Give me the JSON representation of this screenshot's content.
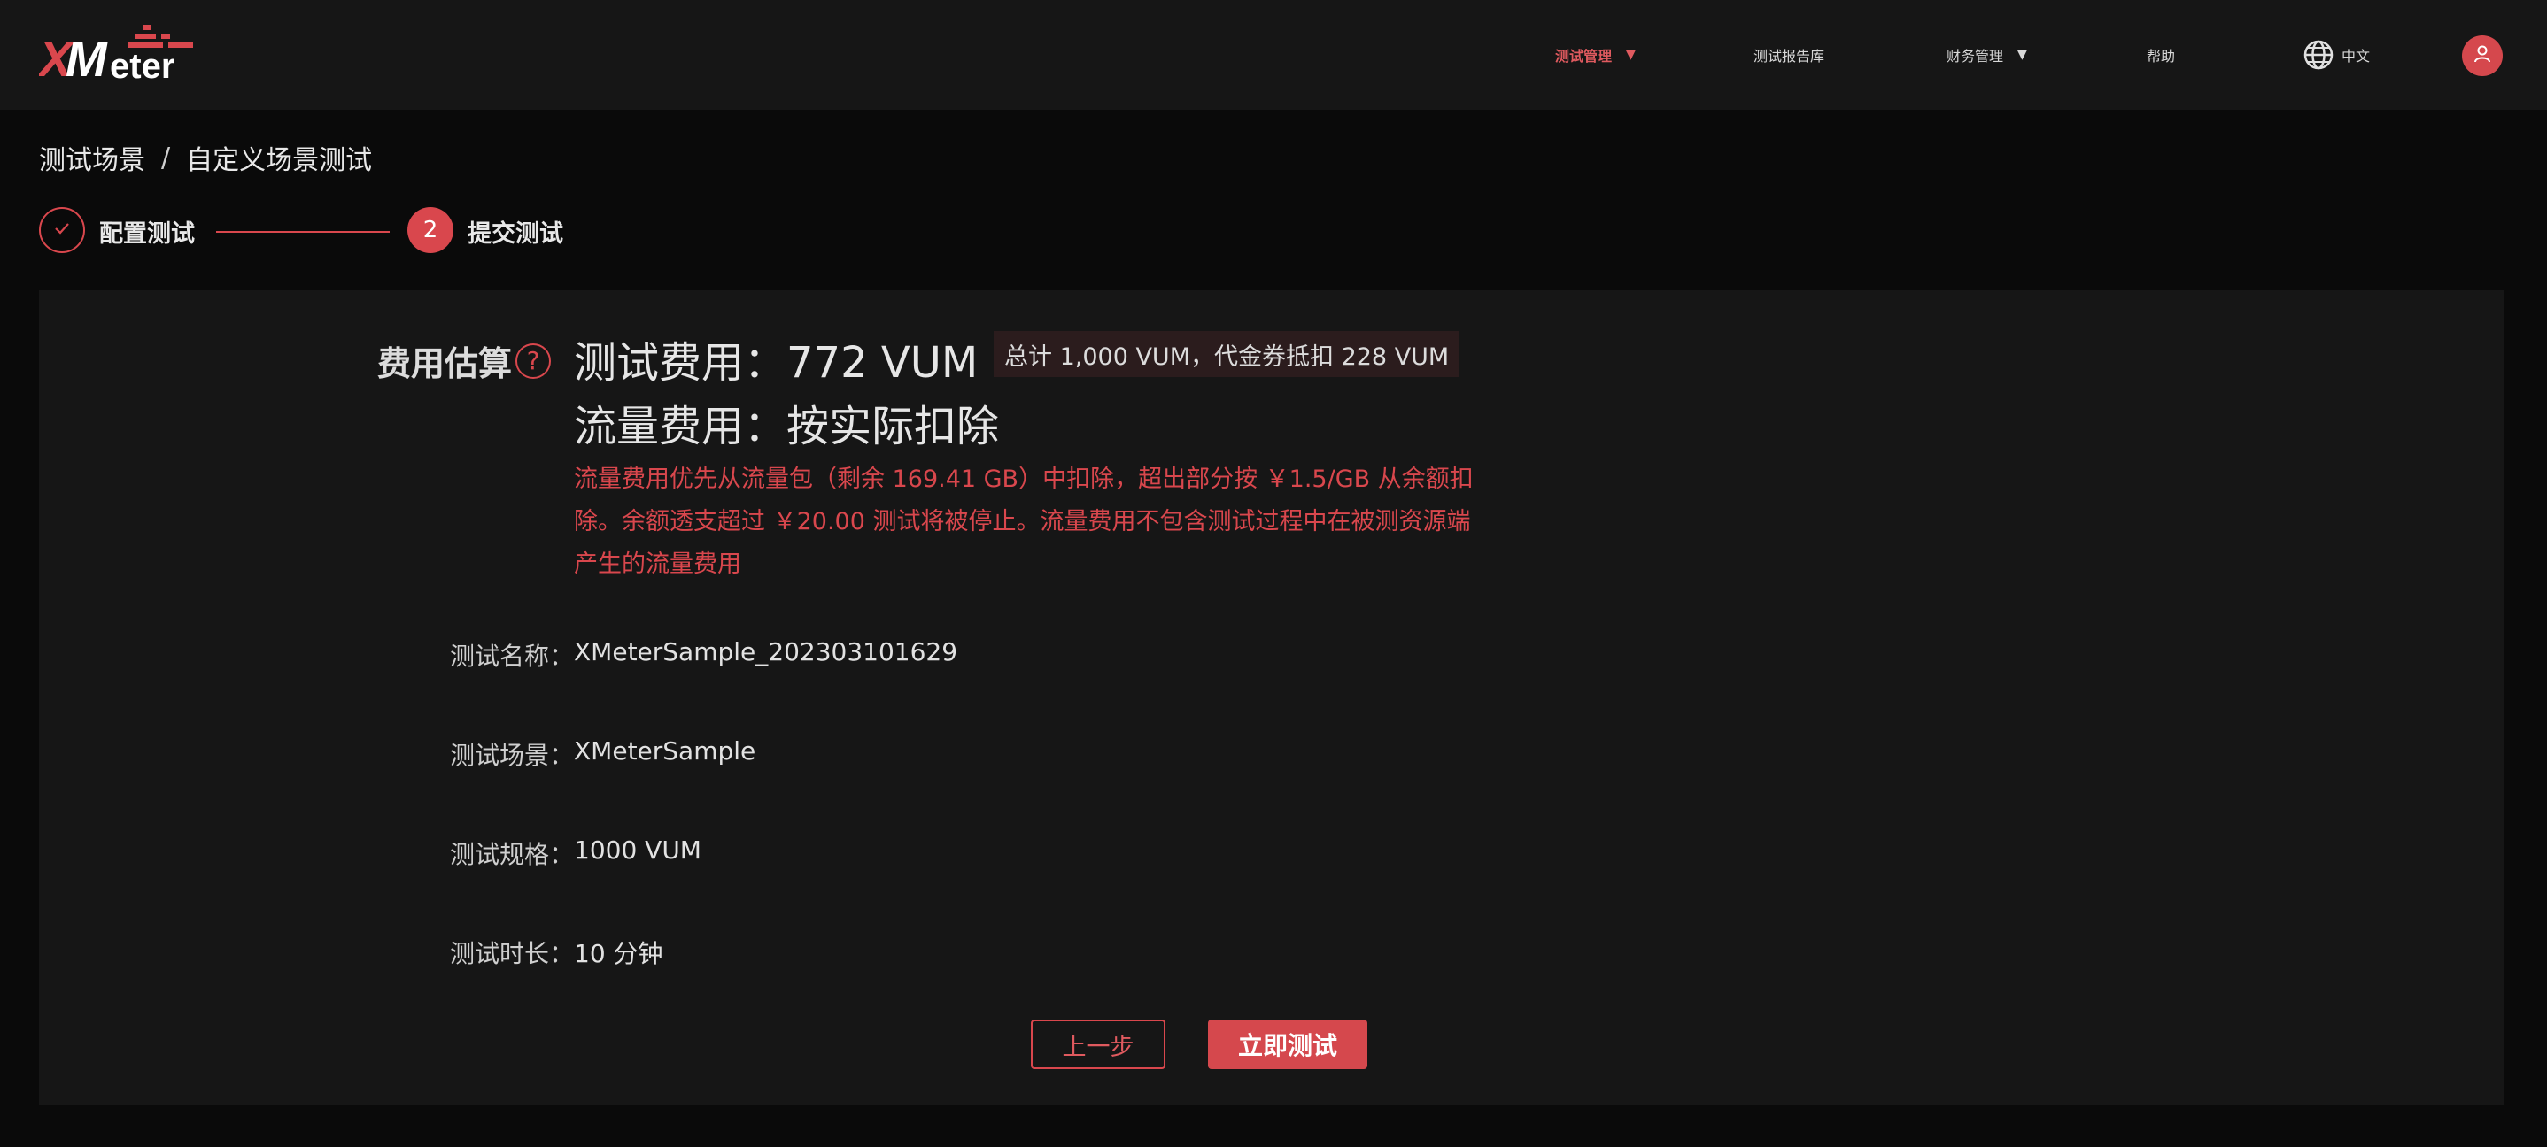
{
  "brand": {
    "logo_text": "XMeter",
    "accent_color": "#d9474d"
  },
  "nav": {
    "items": [
      {
        "label": "测试管理",
        "active": true,
        "has_dropdown": true
      },
      {
        "label": "测试报告库",
        "active": false,
        "has_dropdown": false
      },
      {
        "label": "财务管理",
        "active": false,
        "has_dropdown": true
      },
      {
        "label": "帮助",
        "active": false,
        "has_dropdown": false
      }
    ],
    "language": "中文",
    "language_icon": "globe-icon",
    "avatar_icon": "user-icon"
  },
  "breadcrumb": {
    "items": [
      "测试场景",
      "自定义场景测试"
    ],
    "separator": "/"
  },
  "steps": {
    "step1": {
      "label": "配置测试",
      "status": "done"
    },
    "step2": {
      "label": "提交测试",
      "number": "2",
      "status": "active"
    }
  },
  "estimate": {
    "label": "费用估算",
    "help_symbol": "?",
    "test_cost": "测试费用：772 VUM",
    "badge": "总计 1,000 VUM，代金券抵扣 228 VUM",
    "traffic_cost": "流量费用：按实际扣除",
    "note_lines": [
      "流量费用优先从流量包（剩余 169.41 GB）中扣除，超出部分按 ￥1.5/GB 从余额扣",
      "除。余额透支超过 ￥20.00 测试将被停止。流量费用不包含测试过程中在被测资源端",
      "产生的流量费用"
    ]
  },
  "details": [
    {
      "label": "测试名称：",
      "value": "XMeterSample_202303101629"
    },
    {
      "label": "测试场景：",
      "value": "XMeterSample"
    },
    {
      "label": "测试规格：",
      "value": "1000 VUM"
    },
    {
      "label": "测试时长：",
      "value": "10 分钟"
    }
  ],
  "actions": {
    "prev_label": "上一步",
    "start_label": "立即测试"
  }
}
